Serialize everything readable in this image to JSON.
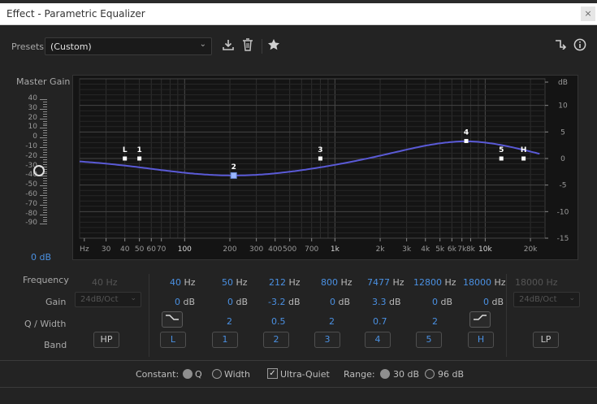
{
  "window": {
    "title": "Effect - Parametric Equalizer",
    "close_glyph": "×"
  },
  "toolbar": {
    "presets_label": "Presets:",
    "preset_value": "(Custom)",
    "icons": [
      "save-preset-icon",
      "delete-preset-icon",
      "favorite-star-icon",
      "route-icon",
      "info-icon"
    ]
  },
  "master": {
    "label": "Master Gain",
    "scale": [
      "40",
      "30",
      "20",
      "10",
      "0",
      "-10",
      "-20",
      "-30",
      "-40",
      "-50",
      "-60",
      "-70",
      "-80",
      "-90"
    ],
    "value": "0 dB"
  },
  "graph": {
    "db_axis": [
      "dB",
      "10",
      "5",
      "0",
      "-5",
      "-10",
      "-15"
    ],
    "freq_axis": [
      "Hz",
      "30",
      "40",
      "50",
      "60",
      "70",
      "100",
      "200",
      "300",
      "400",
      "500",
      "700",
      "1k",
      "2k",
      "3k",
      "4k",
      "5k",
      "6k",
      "7k",
      "8k",
      "10k",
      "20k"
    ],
    "nodes": [
      {
        "label": "L",
        "freq": 40,
        "gain": 0
      },
      {
        "label": "1",
        "freq": 50,
        "gain": 0
      },
      {
        "label": "2",
        "freq": 212,
        "gain": -3.2
      },
      {
        "label": "3",
        "freq": 800,
        "gain": 0
      },
      {
        "label": "4",
        "freq": 7477,
        "gain": 3.3
      },
      {
        "label": "5",
        "freq": 12800,
        "gain": 0
      },
      {
        "label": "H",
        "freq": 18000,
        "gain": 0
      }
    ],
    "curve_color": "#5a5ad6"
  },
  "rows": {
    "frequency": "Frequency",
    "gain": "Gain",
    "q_width": "Q / Width",
    "band": "Band"
  },
  "hp": {
    "freq": "40 Hz",
    "slope": "24dB/Oct",
    "band": "HP"
  },
  "lp": {
    "freq": "18000 Hz",
    "slope": "24dB/Oct",
    "band": "LP"
  },
  "bands": [
    {
      "freq_num": "40",
      "freq_unit": "Hz",
      "gain_num": "0",
      "gain_unit": "dB",
      "q": "",
      "band": "L"
    },
    {
      "freq_num": "50",
      "freq_unit": "Hz",
      "gain_num": "0",
      "gain_unit": "dB",
      "q": "2",
      "band": "1"
    },
    {
      "freq_num": "212",
      "freq_unit": "Hz",
      "gain_num": "-3.2",
      "gain_unit": "dB",
      "q": "0.5",
      "band": "2"
    },
    {
      "freq_num": "800",
      "freq_unit": "Hz",
      "gain_num": "0",
      "gain_unit": "dB",
      "q": "2",
      "band": "3"
    },
    {
      "freq_num": "7477",
      "freq_unit": "Hz",
      "gain_num": "3.3",
      "gain_unit": "dB",
      "q": "0.7",
      "band": "4"
    },
    {
      "freq_num": "12800",
      "freq_unit": "Hz",
      "gain_num": "0",
      "gain_unit": "dB",
      "q": "2",
      "band": "5"
    },
    {
      "freq_num": "18000",
      "freq_unit": "Hz",
      "gain_num": "0",
      "gain_unit": "dB",
      "q": "",
      "band": "H"
    }
  ],
  "shape_glyphs": {
    "low_shelf": "⌒",
    "high_shelf": "⌒"
  },
  "bottom": {
    "constant_label": "Constant:",
    "q_label": "Q",
    "width_label": "Width",
    "ultra_quiet_label": "Ultra-Quiet",
    "ultra_quiet_checked": true,
    "check_glyph": "✓",
    "range_label": "Range:",
    "range_30": "30 dB",
    "range_96": "96 dB",
    "constant_selected": "Q",
    "range_selected": "30 dB"
  }
}
